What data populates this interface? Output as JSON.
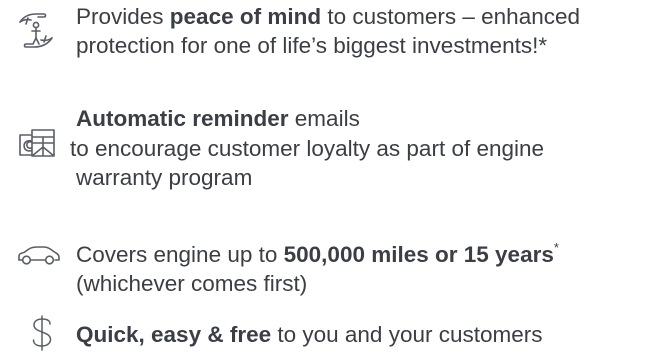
{
  "items": [
    {
      "icon": "hand-holding-person-icon",
      "line1_pre": "Provides ",
      "line1_bold": "peace of mind",
      "line1_post": " to customers – enhanced",
      "line2": "protection for one of life’s biggest investments!*"
    },
    {
      "icon": "email-reminder-icon",
      "line1_bold": "Automatic reminder",
      "line1_post": " emails",
      "line2": "to encourage customer loyalty as part of engine",
      "line3": "warranty program"
    },
    {
      "icon": "car-icon",
      "line1_pre": "Covers engine up to ",
      "line1_bold": "500,000 miles or 15 years",
      "line1_sup": "*",
      "line2": "(whichever comes first)"
    },
    {
      "icon": "dollar-sign-icon",
      "line1_bold": "Quick, easy & free",
      "line1_post": " to you and your customers"
    }
  ],
  "colors": {
    "text": "#3b3e45",
    "icon": "#5a5e66"
  }
}
